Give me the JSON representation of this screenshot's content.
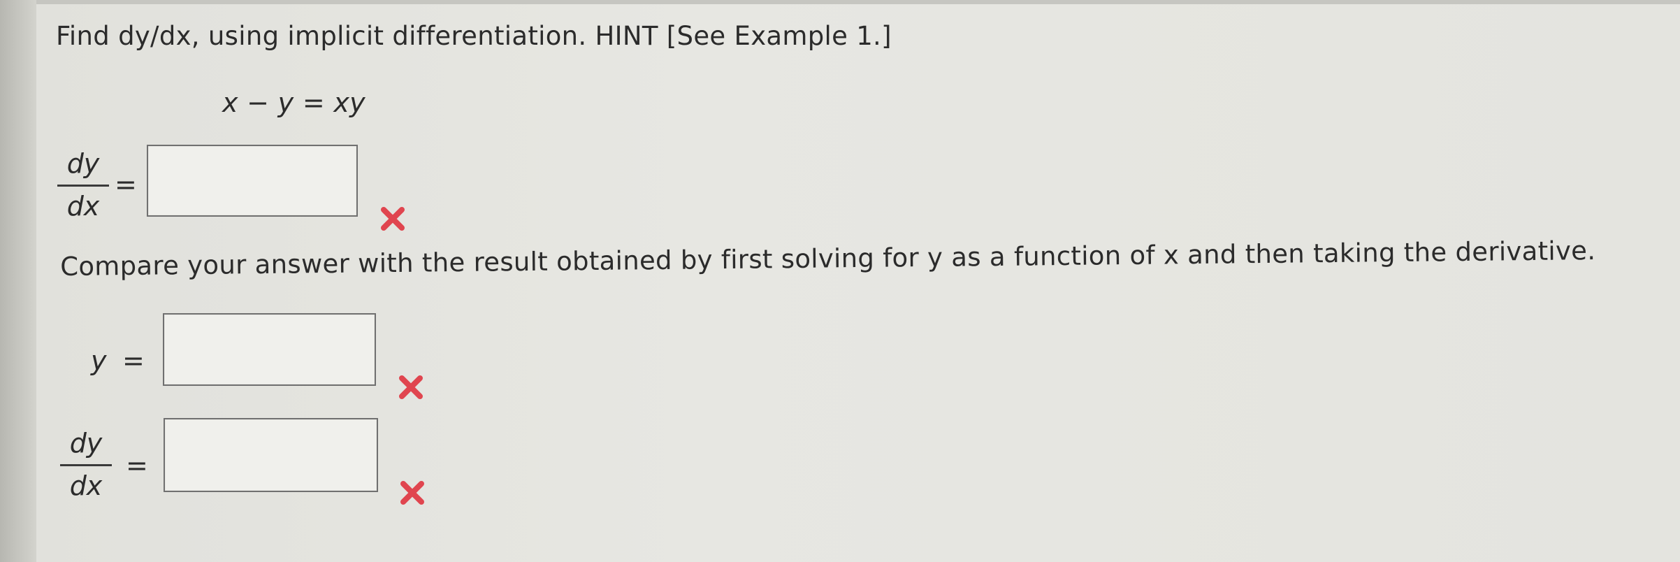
{
  "question": {
    "instruction": "Find dy/dx, using implicit differentiation. HINT [See Example 1.]",
    "equation": "x − y = xy"
  },
  "part1": {
    "lhs_numerator": "dy",
    "lhs_denominator": "dx",
    "equals": "=",
    "answer_value": "",
    "status_icon": "red-x-icon"
  },
  "compare_text": "Compare your answer with the result obtained by first solving for y as a function of x and then taking the derivative.",
  "part2": {
    "lhs": "y",
    "equals": "=",
    "answer_value": "",
    "status_icon": "red-x-icon"
  },
  "part3": {
    "lhs_numerator": "dy",
    "lhs_denominator": "dx",
    "equals": "=",
    "answer_value": "",
    "status_icon": "red-x-icon"
  },
  "colors": {
    "wrong_mark": "#e0454f",
    "box_border": "#707070"
  }
}
